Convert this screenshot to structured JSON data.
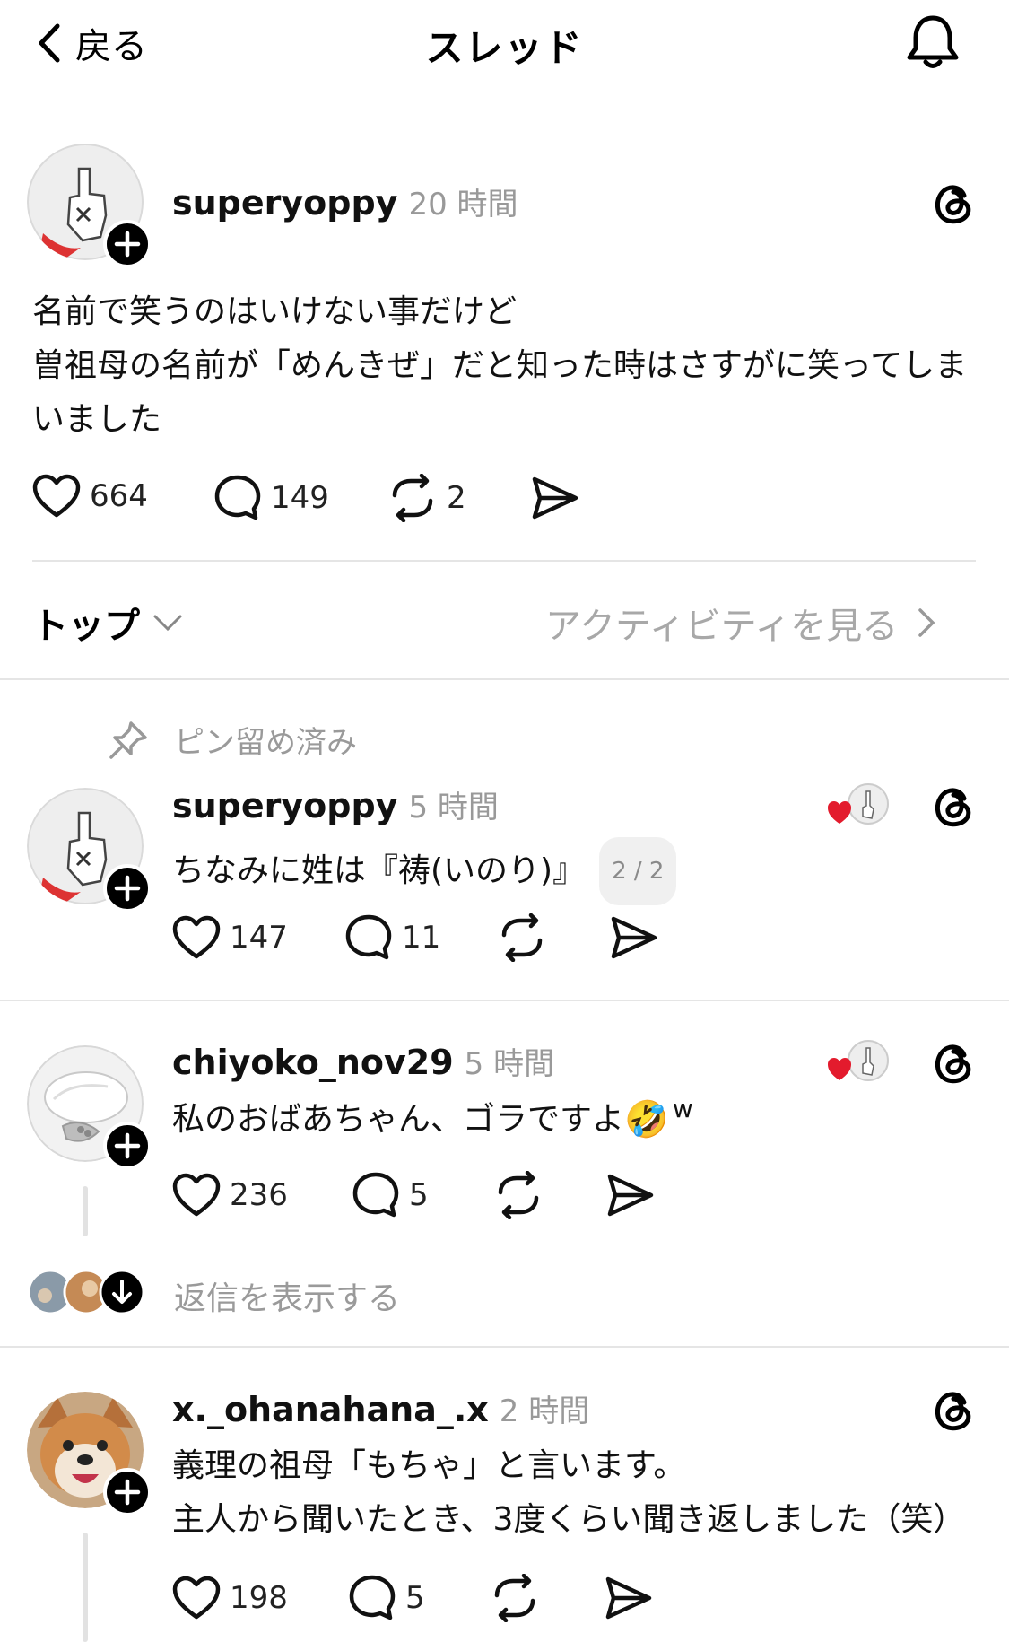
{
  "header": {
    "back_label": "戻る",
    "title": "スレッド"
  },
  "main_post": {
    "username": "superyoppy",
    "time": "20 時間",
    "text_lines": [
      "名前で笑うのはいけない事だけど",
      "曽祖母の名前が「めんきぜ」だと知った時はさすがに笑ってしま",
      "いました"
    ],
    "likes": "664",
    "comments": "149",
    "reposts": "2"
  },
  "sort_bar": {
    "sort_label": "トップ",
    "activity_label": "アクティビティを見る"
  },
  "replies": [
    {
      "pinned_label": "ピン留め済み",
      "username": "superyoppy",
      "time": "5 時間",
      "text": "ちなみに姓は『祷(いのり)』",
      "badge": "2 / 2",
      "likes": "147",
      "comments": "11"
    },
    {
      "username": "chiyoko_nov29",
      "time": "5 時間",
      "text": "私のおばあちゃん、ゴラですよ",
      "emoji": "🤣",
      "suffix": "w",
      "likes": "236",
      "comments": "5",
      "show_replies_label": "返信を表示する"
    },
    {
      "username": "x._ohanahana_.x",
      "time": "2 時間",
      "text_lines": [
        "義理の祖母「もちゃ」と言います。",
        "主人から聞いたとき、3度くらい聞き返しました（笑）"
      ],
      "likes": "198",
      "comments": "5"
    }
  ]
}
